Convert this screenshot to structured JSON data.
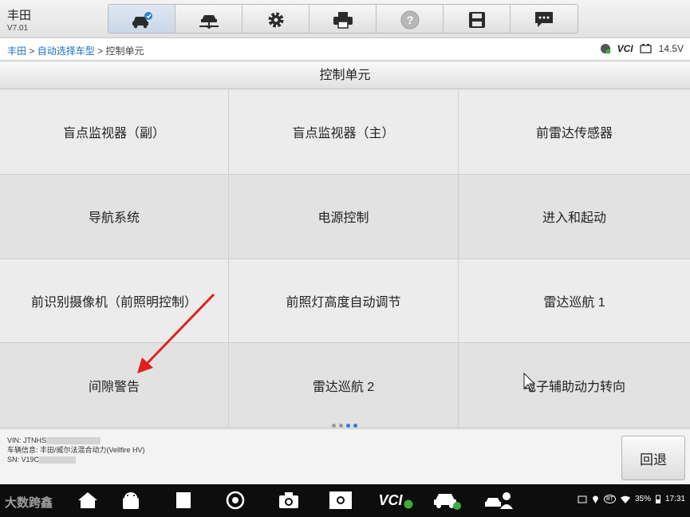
{
  "header": {
    "title": "丰田",
    "version": "V7.01",
    "tools": [
      {
        "icon": "car-diagnose-icon"
      },
      {
        "icon": "car-lift-icon"
      },
      {
        "icon": "gear-icon"
      },
      {
        "icon": "printer-icon"
      },
      {
        "icon": "help-icon"
      },
      {
        "icon": "save-icon"
      },
      {
        "icon": "message-icon"
      }
    ]
  },
  "breadcrumb": {
    "items": [
      "丰田",
      "自动选择车型",
      "控制单元"
    ],
    "separator": ">"
  },
  "status": {
    "vci_label": "VCI",
    "voltage": "14.5V"
  },
  "section_title": "控制单元",
  "units": [
    "盲点监视器（副）",
    "盲点监视器（主）",
    "前雷达传感器",
    "导航系统",
    "电源控制",
    "进入和起动",
    "前识别摄像机（前照明控制）",
    "前照灯高度自动调节",
    "雷达巡航 1",
    "间隙警告",
    "雷达巡航 2",
    "电子辅助动力转向"
  ],
  "pager": {
    "pages": 4,
    "current": 3
  },
  "vehicle_info": {
    "vin_label": "VIN: JTNHS",
    "info_label": "车辆信息: 丰田/威尔法混合动力(Vellfire HV)",
    "sn_label": "SN: V19C"
  },
  "back_button": "回退",
  "android": {
    "battery": "35%",
    "time": "17:31",
    "bt_label": "BT",
    "vci_label": "VCI",
    "watermark": "大数跨鑫"
  },
  "colors": {
    "accent": "#1a6fc2",
    "arrow": "#e02020"
  }
}
